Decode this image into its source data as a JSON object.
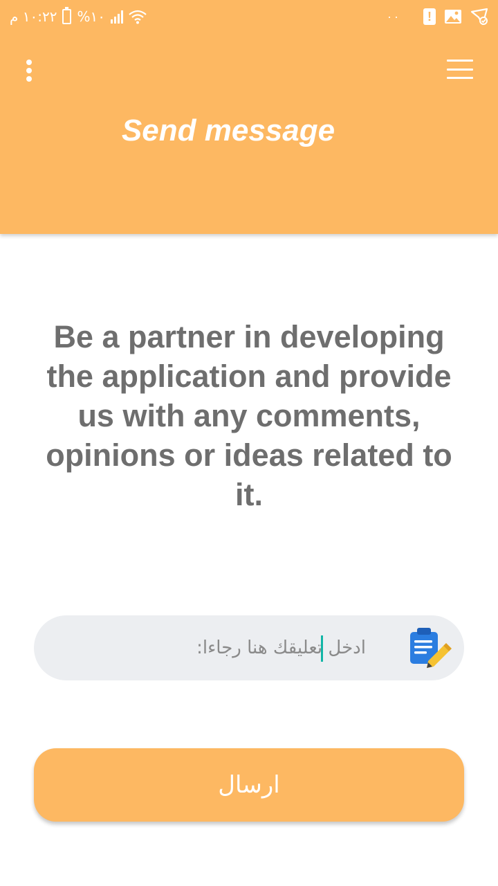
{
  "status_bar": {
    "time": "١٠:٢٢ م",
    "battery": "%١٠",
    "dots": "··"
  },
  "header": {
    "title": "Send message",
    "more_icon": "more-vertical-icon",
    "menu_icon": "hamburger-menu-icon",
    "background": "#FDB862"
  },
  "main": {
    "intro_text": "Be a partner in developing the application and provide us with any comments, opinions or ideas related to it.",
    "comment": {
      "placeholder": "ادخل تعليقك هنا رجاءا:",
      "value": "",
      "icon": "clipboard-edit-icon"
    },
    "send_label": "ارسال"
  },
  "colors": {
    "accent": "#FDB862",
    "text_gray": "#6E6E6E",
    "input_bg": "#ECEEF1",
    "caret": "#12B5A6",
    "icon_blue": "#2B7DE0",
    "icon_yellow": "#F5C232"
  }
}
